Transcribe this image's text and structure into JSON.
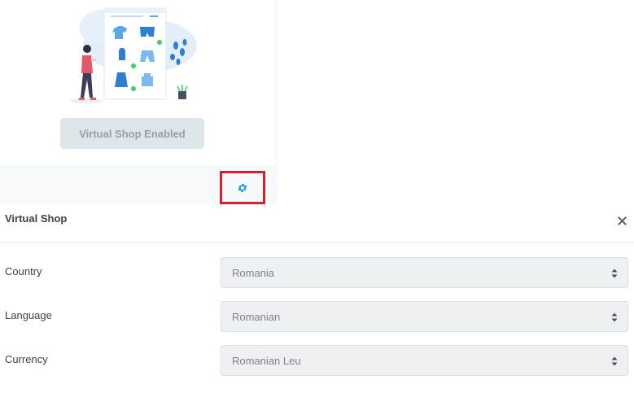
{
  "card": {
    "status_button_label": "Virtual Shop Enabled",
    "settings_icon": "gear-icon"
  },
  "panel": {
    "title": "Virtual Shop",
    "close_icon": "close-icon"
  },
  "form": {
    "fields": [
      {
        "label": "Country",
        "value": "Romania"
      },
      {
        "label": "Language",
        "value": "Romanian"
      },
      {
        "label": "Currency",
        "value": "Romanian Leu"
      }
    ]
  },
  "colors": {
    "accent": "#2a9fd8",
    "highlight": "#d6202b",
    "button_bg": "#dde7ea",
    "select_bg": "#eff0f2"
  }
}
